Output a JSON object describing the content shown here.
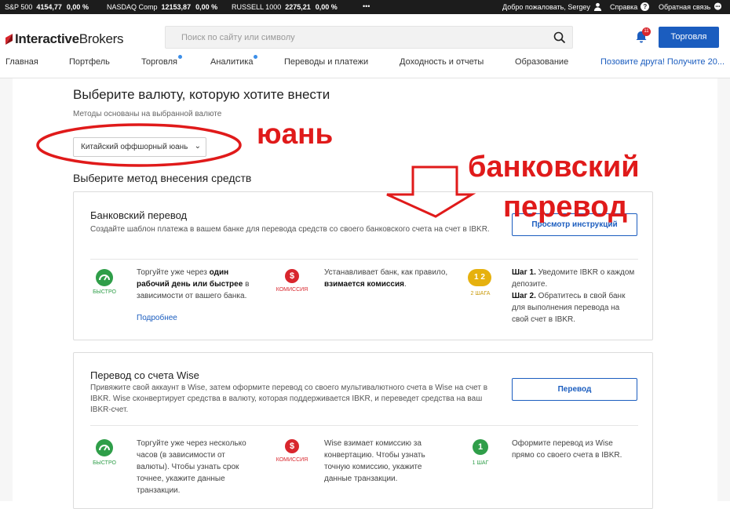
{
  "ticker": {
    "items": [
      {
        "name": "S&P 500",
        "value": "4154,77",
        "change": "0,00 %"
      },
      {
        "name": "NASDAQ Comp",
        "value": "12153,87",
        "change": "0,00 %"
      },
      {
        "name": "RUSSELL 1000",
        "value": "2275,21",
        "change": "0,00 %"
      }
    ],
    "more": "•••",
    "welcome": "Добро пожаловать, Sergey",
    "help": "Справка",
    "feedback": "Обратная связь"
  },
  "header": {
    "logo_bold": "Interactive",
    "logo_rest": "Brokers",
    "search_placeholder": "Поиск по сайту или символу",
    "notif_count": "11",
    "trade_button": "Торговля",
    "nav": [
      "Главная",
      "Портфель",
      "Торговля",
      "Аналитика",
      "Переводы и платежи",
      "Доходность и отчеты",
      "Образование",
      "Позовите друга! Получите 20..."
    ]
  },
  "main": {
    "title": "Выберите валюту, которую хотите внести",
    "subtitle": "Методы основаны на выбранной валюте",
    "currency_selected": "Китайский оффшорный юань",
    "method_title": "Выберите метод внесения средств"
  },
  "bank_card": {
    "title": "Банковский перевод",
    "desc": "Создайте шаблон платежа в вашем банке для перевода средств со своего банковского счета на счет в IBKR.",
    "button": "Просмотр инструкций",
    "speed_label": "БЫСТРО",
    "speed_text_1": "Торгуйте уже через ",
    "speed_text_bold": "один рабочий день или быстрее",
    "speed_text_2": " в зависимости от вашего банка.",
    "more_link": "Подробнее",
    "fee_label": "КОМИССИЯ",
    "fee_text_1": "Устанавливает банк, как правило, ",
    "fee_text_bold": "взимается комиссия",
    "fee_text_2": ".",
    "steps_label": "2 ШАГА",
    "step1_bold": "Шаг 1.",
    "step1_text": " Уведомите IBKR о каждом депозите.",
    "step2_bold": "Шаг 2.",
    "step2_text": " Обратитесь в свой банк для выполнения перевода на свой счет в IBKR."
  },
  "wise_card": {
    "title": "Перевод со счета Wise",
    "desc": "Привяжите свой аккаунт в Wise, затем оформите перевод со своего мультивалютного счета в Wise на счет в IBKR. Wise сконвертирует средства в валюту, которая поддерживается IBKR, и переведет средства на ваш IBKR-счет.",
    "button": "Перевод",
    "speed_label": "БЫСТРО",
    "speed_text": "Торгуйте уже через несколько часов (в зависимости от валюты). Чтобы узнать срок точнее, укажите данные транзакции.",
    "fee_label": "КОМИССИЯ",
    "fee_text": "Wise взимает комиссию за конвертацию. Чтобы узнать точную комиссию, укажите данные транзакции.",
    "steps_label": "1 ШАГ",
    "steps_text": "Оформите перевод из Wise прямо со своего счета в IBKR."
  },
  "annotations": {
    "yuan": "юань",
    "bank1": "банковский",
    "bank2": "перевод",
    "color": "#e01a1a"
  },
  "colors": {
    "accent": "#1b5dbf",
    "green": "#2f9e49",
    "red": "#d8262d",
    "gold": "#e6b10e"
  }
}
